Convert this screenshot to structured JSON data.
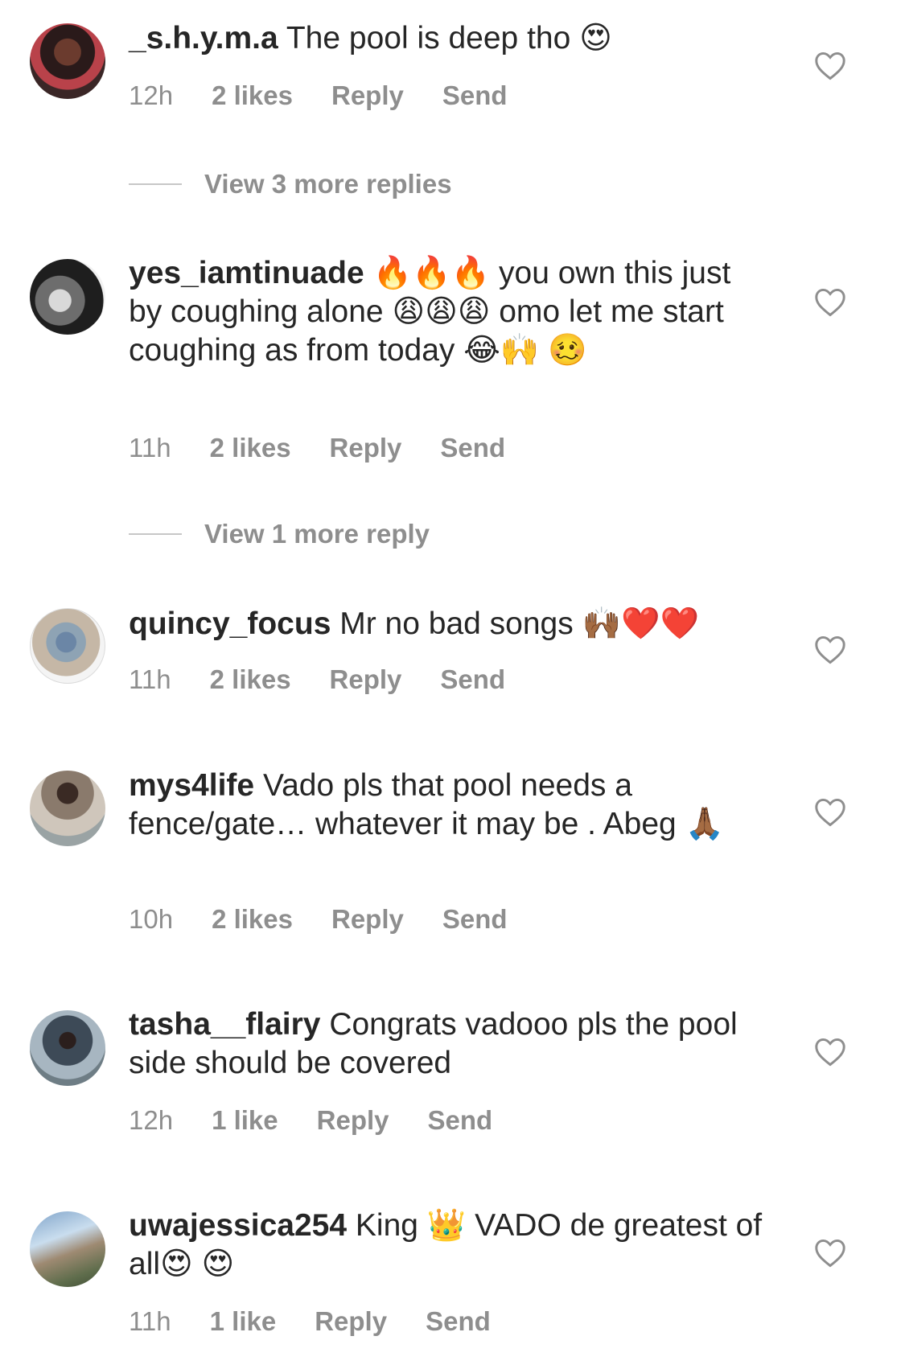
{
  "comments": [
    {
      "username": "_s.h.y.m.a",
      "text": "The pool is deep tho 😍",
      "time": "12h",
      "likes": "2 likes",
      "reply_label": "Reply",
      "send_label": "Send"
    },
    {
      "username": "yes_iamtinuade",
      "text": "🔥🔥🔥 you own this just by coughing alone 😩😩😩 omo let me start coughing as from today 😂🙌 🥴",
      "time": "11h",
      "likes": "2 likes",
      "reply_label": "Reply",
      "send_label": "Send"
    },
    {
      "username": "quincy_focus",
      "text": "Mr no bad songs 🙌🏾❤️❤️",
      "time": "11h",
      "likes": "2 likes",
      "reply_label": "Reply",
      "send_label": "Send"
    },
    {
      "username": "mys4life",
      "text": "Vado pls that pool needs a fence/gate… whatever it may be . Abeg 🙏🏾",
      "time": "10h",
      "likes": "2 likes",
      "reply_label": "Reply",
      "send_label": "Send"
    },
    {
      "username": "tasha__flairy",
      "text": "Congrats vadooo pls the pool side should be covered",
      "time": "12h",
      "likes": "1 like",
      "reply_label": "Reply",
      "send_label": "Send"
    },
    {
      "username": "uwajessica254",
      "text": "King 👑 VADO de greatest of all😍 😍",
      "time": "11h",
      "likes": "1 like",
      "reply_label": "Reply",
      "send_label": "Send"
    }
  ],
  "view_replies": [
    "View 3 more replies",
    "View 1 more reply"
  ],
  "icons": {
    "like": "heart-outline-icon"
  },
  "colors": {
    "text": "#262626",
    "meta": "#8e8e8e"
  }
}
